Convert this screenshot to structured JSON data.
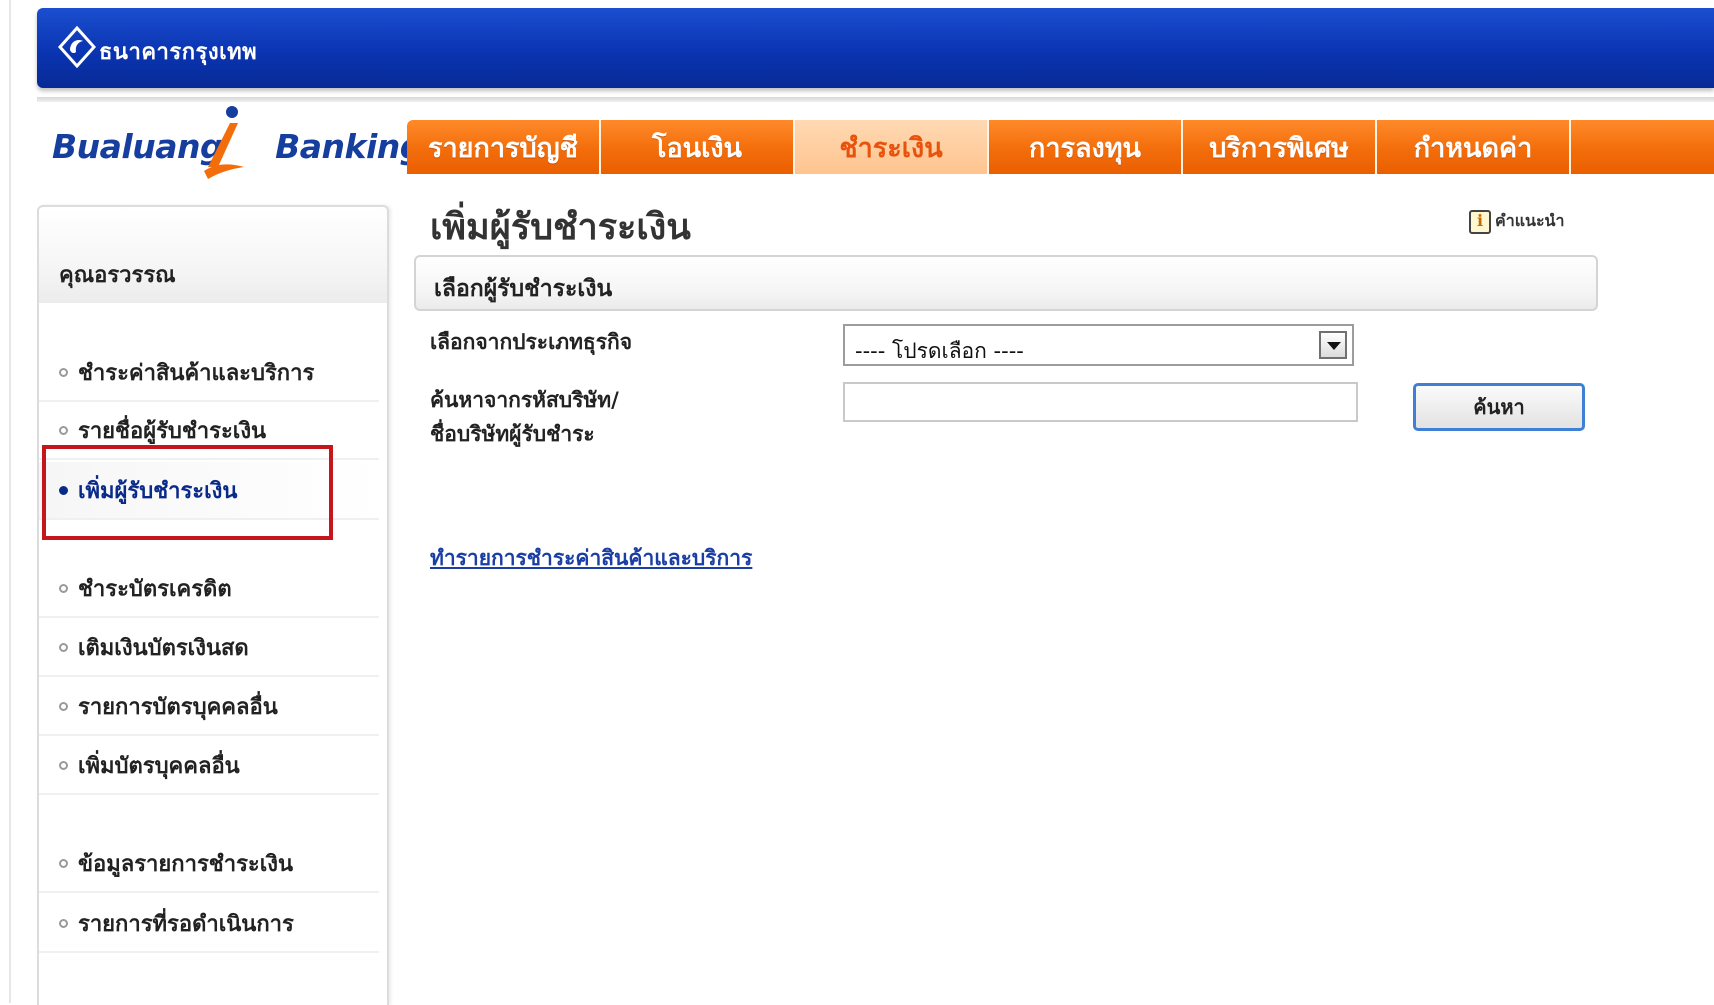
{
  "header": {
    "bank_name": "ธนาคารกรุงเทพ",
    "brand_part1": "Bualuang",
    "brand_part2": "Banking"
  },
  "nav": {
    "items": [
      {
        "label": "รายการบัญชี",
        "active": false
      },
      {
        "label": "โอนเงิน",
        "active": false
      },
      {
        "label": "ชำระเงิน",
        "active": true
      },
      {
        "label": "การลงทุน",
        "active": false
      },
      {
        "label": "บริการพิเศษ",
        "active": false
      },
      {
        "label": "กำหนดค่า",
        "active": false
      }
    ]
  },
  "sidebar": {
    "user_name": "คุณอรวรรณ",
    "items": [
      {
        "label": "ชำระค่าสินค้าและบริการ"
      },
      {
        "label": "รายชื่อผู้รับชำระเงิน"
      },
      {
        "label": "เพิ่มผู้รับชำระเงิน",
        "active": true
      },
      {
        "label": "ชำระบัตรเครดิต"
      },
      {
        "label": "เติมเงินบัตรเงินสด"
      },
      {
        "label": "รายการบัตรบุคคลอื่น"
      },
      {
        "label": "เพิ่มบัตรบุคคลอื่น"
      },
      {
        "label": "ข้อมูลรายการชำระเงิน"
      },
      {
        "label": "รายการที่รอดำเนินการ"
      }
    ]
  },
  "main": {
    "page_title": "เพิ่มผู้รับชำระเงิน",
    "help_label": "คำแนะนำ",
    "section_title": "เลือกผู้รับชำระเงิน",
    "business_type_label": "เลือกจากประเภทธุรกิจ",
    "business_type_value": "---- โปรดเลือก ----",
    "search_label_line1": "ค้นหาจากรหัสบริษัท/",
    "search_label_line2": "ชื่อบริษัทผู้รับชำระ",
    "search_value": "",
    "search_button": "ค้นหา",
    "link_text": "ทำรายการชำระค่าสินค้าและบริการ"
  },
  "colors": {
    "header_blue": "#0a34b2",
    "nav_orange": "#f36d0b",
    "active_tab_bg": "#ffc48f",
    "highlight_red": "#c4161c",
    "link_blue": "#1a3ea3"
  }
}
